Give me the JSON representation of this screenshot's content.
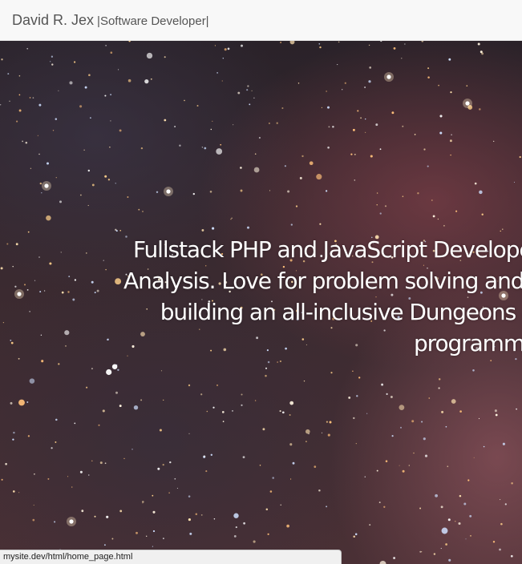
{
  "navbar": {
    "brand_name": "David R. Jex",
    "brand_separator": "|",
    "brand_title": "Software Developer|"
  },
  "hero": {
    "headline_lines": [
      "Fullstack PHP and JavaScript Developer",
      "Analysis. Love for problem solving and cr",
      "building an all-inclusive Dungeons and",
      "programm"
    ]
  },
  "status_bar": {
    "url": "mysite.dev/html/home_page.html"
  }
}
